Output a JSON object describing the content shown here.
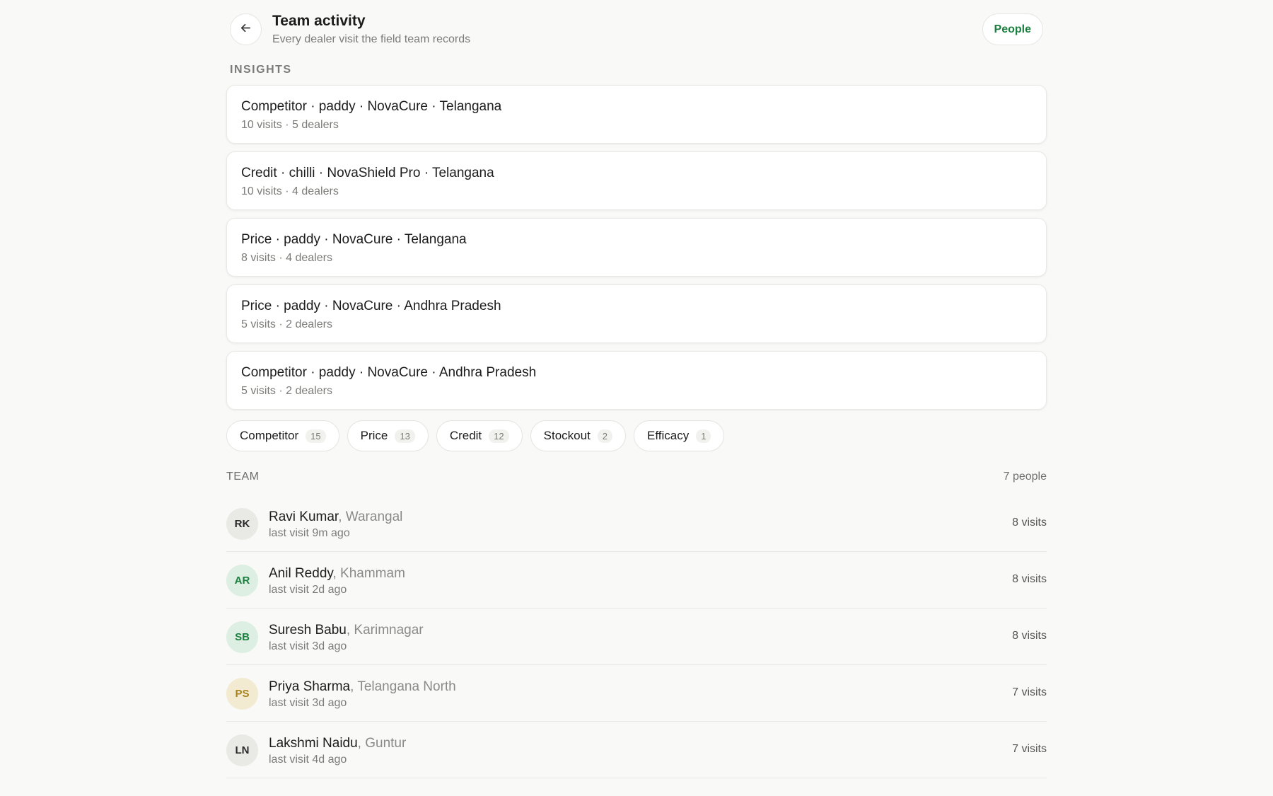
{
  "header": {
    "title": "Team activity",
    "subtitle": "Every dealer visit the field team records",
    "people_button": "People"
  },
  "insights": {
    "label": "INSIGHTS",
    "items": [
      {
        "title": "Competitor · paddy · NovaCure · Telangana",
        "meta": "10 visits · 5 dealers"
      },
      {
        "title": "Credit · chilli · NovaShield Pro · Telangana",
        "meta": "10 visits · 4 dealers"
      },
      {
        "title": "Price · paddy · NovaCure · Telangana",
        "meta": "8 visits · 4 dealers"
      },
      {
        "title": "Price · paddy · NovaCure · Andhra Pradesh",
        "meta": "5 visits · 2 dealers"
      },
      {
        "title": "Competitor · paddy · NovaCure · Andhra Pradesh",
        "meta": "5 visits · 2 dealers"
      }
    ]
  },
  "filters": [
    {
      "label": "Competitor",
      "count": "15"
    },
    {
      "label": "Price",
      "count": "13"
    },
    {
      "label": "Credit",
      "count": "12"
    },
    {
      "label": "Stockout",
      "count": "2"
    },
    {
      "label": "Efficacy",
      "count": "1"
    }
  ],
  "team": {
    "label": "TEAM",
    "count": "7 people",
    "members": [
      {
        "initials": "RK",
        "name": "Ravi Kumar",
        "location": ", Warangal",
        "last_visit": "last visit 9m ago",
        "visits": "8 visits",
        "avatar_bg": "#e9e9e6",
        "avatar_fg": "#2a2a2a"
      },
      {
        "initials": "AR",
        "name": "Anil Reddy",
        "location": ", Khammam",
        "last_visit": "last visit 2d ago",
        "visits": "8 visits",
        "avatar_bg": "#dcefe2",
        "avatar_fg": "#1a7f3f"
      },
      {
        "initials": "SB",
        "name": "Suresh Babu",
        "location": ", Karimnagar",
        "last_visit": "last visit 3d ago",
        "visits": "8 visits",
        "avatar_bg": "#dcefe2",
        "avatar_fg": "#1a7f3f"
      },
      {
        "initials": "PS",
        "name": "Priya Sharma",
        "location": ", Telangana North",
        "last_visit": "last visit 3d ago",
        "visits": "7 visits",
        "avatar_bg": "#f3ead2",
        "avatar_fg": "#a8841f"
      },
      {
        "initials": "LN",
        "name": "Lakshmi Naidu",
        "location": ", Guntur",
        "last_visit": "last visit 4d ago",
        "visits": "7 visits",
        "avatar_bg": "#e9e9e6",
        "avatar_fg": "#2a2a2a"
      }
    ]
  },
  "colors": {
    "accent": "#1a7f3f",
    "background": "#f9f9f7"
  }
}
